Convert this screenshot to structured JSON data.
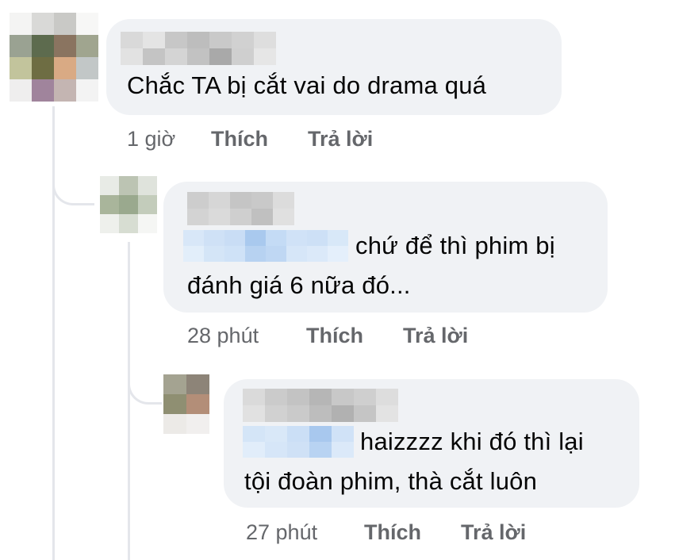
{
  "comments": [
    {
      "text_lines": [
        "Chắc TA bị cắt vai do drama quá"
      ],
      "time": "1 giờ",
      "like_label": "Thích",
      "reply_label": "Trả lời"
    },
    {
      "text_lines": [
        "chứ để thì phim bị",
        "đánh giá 6 nữa đó..."
      ],
      "time": "28 phút",
      "like_label": "Thích",
      "reply_label": "Trả lời"
    },
    {
      "text_lines": [
        "haizzzz khi đó thì lại",
        "tội đoàn phim, thà cắt luôn"
      ],
      "time": "27 phút",
      "like_label": "Thích",
      "reply_label": "Trả lời"
    }
  ],
  "colors": {
    "bubble": "#f0f2f5",
    "meta_text": "#65676b",
    "thread_line": "#e4e6eb",
    "mention_blur": "#bcd6f4"
  }
}
